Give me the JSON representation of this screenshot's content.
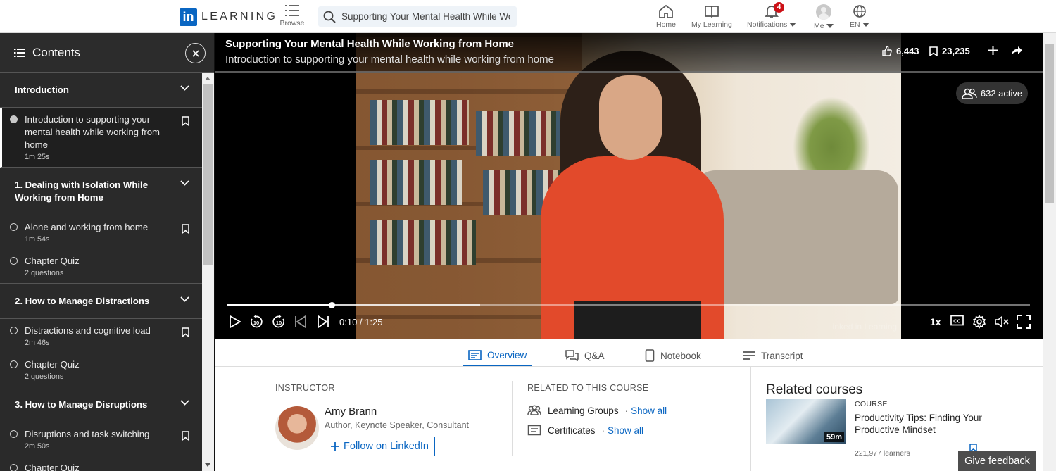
{
  "brand": {
    "logo_in": "in",
    "logo_word": "LEARNING"
  },
  "topnav": {
    "browse_label": "Browse",
    "search_value": "Supporting Your Mental Health While Working from Home",
    "home_label": "Home",
    "mylearning_label": "My Learning",
    "notifications_label": "Notifications",
    "notifications_count": "4",
    "me_label": "Me",
    "lang_label": "EN"
  },
  "sidebar": {
    "title": "Contents",
    "sections": [
      {
        "title": "Introduction"
      },
      {
        "title": "1. Dealing with Isolation While Working from Home"
      },
      {
        "title": "2. How to Manage Distractions"
      },
      {
        "title": "3. How to Manage Disruptions"
      }
    ],
    "items": [
      {
        "title": "Introduction to supporting your mental health while working from home",
        "detail": "1m 25s"
      },
      {
        "title": "Alone and working from home",
        "detail": "1m 54s"
      },
      {
        "title": "Chapter Quiz",
        "detail": "2 questions"
      },
      {
        "title": "Distractions and cognitive load",
        "detail": "2m 46s"
      },
      {
        "title": "Chapter Quiz",
        "detail": "2 questions"
      },
      {
        "title": "Disruptions and task switching",
        "detail": "2m 50s"
      },
      {
        "title": "Chapter Quiz",
        "detail": ""
      }
    ]
  },
  "video": {
    "title": "Supporting Your Mental Health While Working from Home",
    "subtitle": "Introduction to supporting your mental health while working from home",
    "likes": "6,443",
    "saves": "23,235",
    "active": "632 active",
    "timecode": "0:10 / 1:25",
    "progress": 0.1294,
    "buffered": 0.315,
    "speed": "1x",
    "watermark": "Linked in Learning"
  },
  "tabs": [
    {
      "label": "Overview"
    },
    {
      "label": "Q&A"
    },
    {
      "label": "Notebook"
    },
    {
      "label": "Transcript"
    }
  ],
  "overview": {
    "instructor_heading": "INSTRUCTOR",
    "instructor_name": "Amy Brann",
    "instructor_role": "Author, Keynote Speaker, Consultant",
    "follow_label": "Follow on LinkedIn",
    "related_heading": "RELATED TO THIS COURSE",
    "groups_label": "Learning Groups",
    "certs_label": "Certificates",
    "show_all": "Show all",
    "sep": "·"
  },
  "related": {
    "title": "Related courses",
    "kind": "COURSE",
    "name": "Productivity Tips: Finding Your Productive Mindset",
    "duration": "59m",
    "learners": "221,977 learners"
  },
  "feedback_label": "Give feedback",
  "colors": {
    "brand": "#0a66c2",
    "badge": "#cc1016",
    "sidebar": "#2a2a2a"
  }
}
